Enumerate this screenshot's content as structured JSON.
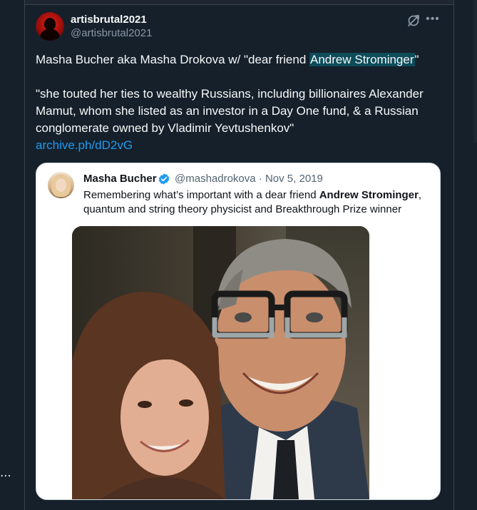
{
  "tweet": {
    "author": {
      "display_name": "artisbrutal2021",
      "handle": "@artisbrutal2021",
      "avatar_icon": "red-silhouette-avatar"
    },
    "text": {
      "line1_prefix": "Masha Bucher aka Masha Drokova w/ \"dear friend ",
      "line1_highlight": "Andrew Strominger",
      "line1_suffix": "\"",
      "line2": "\"she touted her ties to wealthy Russians, including billionaires Alexander Mamut, whom she listed as an investor in a Day One fund, & a Russian conglomerate owned by Vladimir Yevtushenkov\"",
      "link": "archive.ph/dD2vG"
    },
    "grok_icon": "grok-icon",
    "more_icon": "more-icon"
  },
  "quote": {
    "display_name": "Masha Bucher",
    "handle": "@mashadrokova",
    "date": "Nov 5, 2019",
    "separator": "·",
    "verified_icon": "verified-badge-icon",
    "text_prefix": "Remembering what’s important with a dear friend ",
    "text_bold": "Andrew Strominger",
    "text_suffix": ", quantum and string theory physicist and Breakthrough Prize winner",
    "photo_description_icon": "selfie-photo"
  },
  "colors": {
    "background": "#15202b",
    "link": "#1d9bf0",
    "highlight": "#0e4c5a",
    "verified": "#1d9bf0"
  }
}
